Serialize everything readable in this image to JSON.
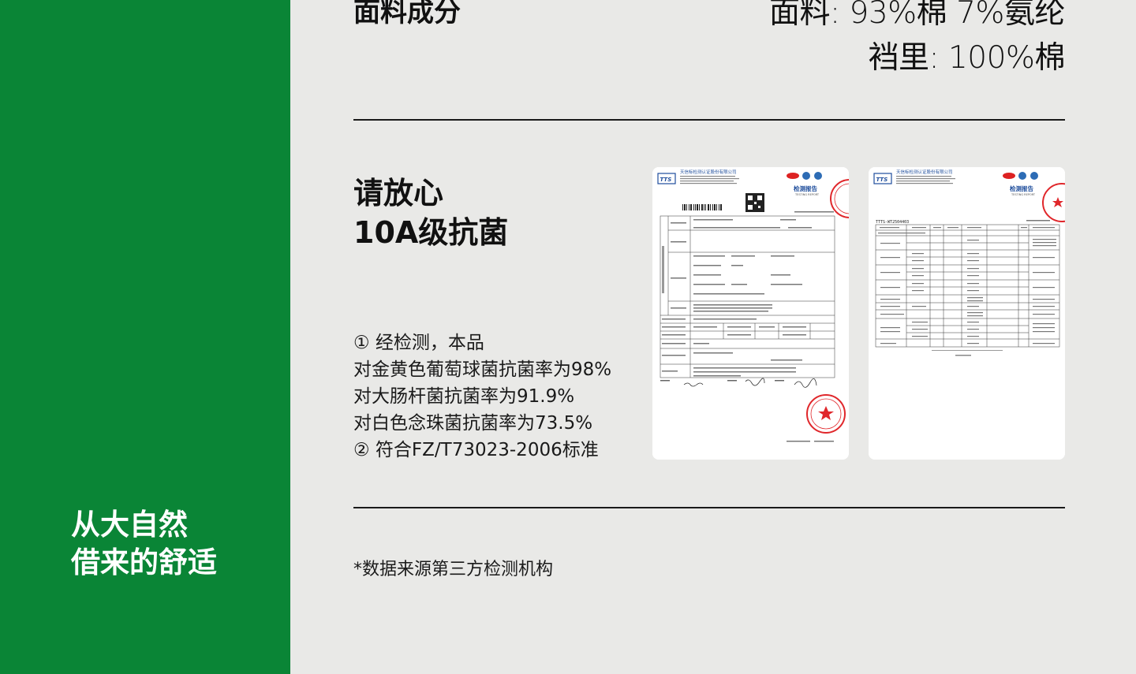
{
  "sidebar": {
    "tagline_line1": "从大自然",
    "tagline_line2": "借来的舒适",
    "color": "#0a8536"
  },
  "fabric": {
    "label": "面料成分",
    "value_main": "面料: 93%棉 7%氨纶",
    "value_crotch": "裆里: 100%棉"
  },
  "antibacterial": {
    "heading_line1": "请放心",
    "heading_line2": "10A级抗菌",
    "points": [
      "① 经检测，本品",
      "对金黄色葡萄球菌抗菌率为98%",
      "对大肠杆菌抗菌率为91.9%",
      "对白色念珠菌抗菌率为73.5%",
      "② 符合FZ/T73023-2006标准"
    ]
  },
  "reports": {
    "report1": {
      "company": "天信标检测认证股份有限公司",
      "title": "检测报告",
      "subtitle": "TESTING REPORT",
      "stamp_color": "#e0272b"
    },
    "report2": {
      "company": "天信标检测认证股份有限公司",
      "title": "检测报告",
      "subtitle": "TESTING REPORT",
      "number": "TTTS-WT2504403"
    }
  },
  "footnote": "*数据来源第三方检测机构"
}
